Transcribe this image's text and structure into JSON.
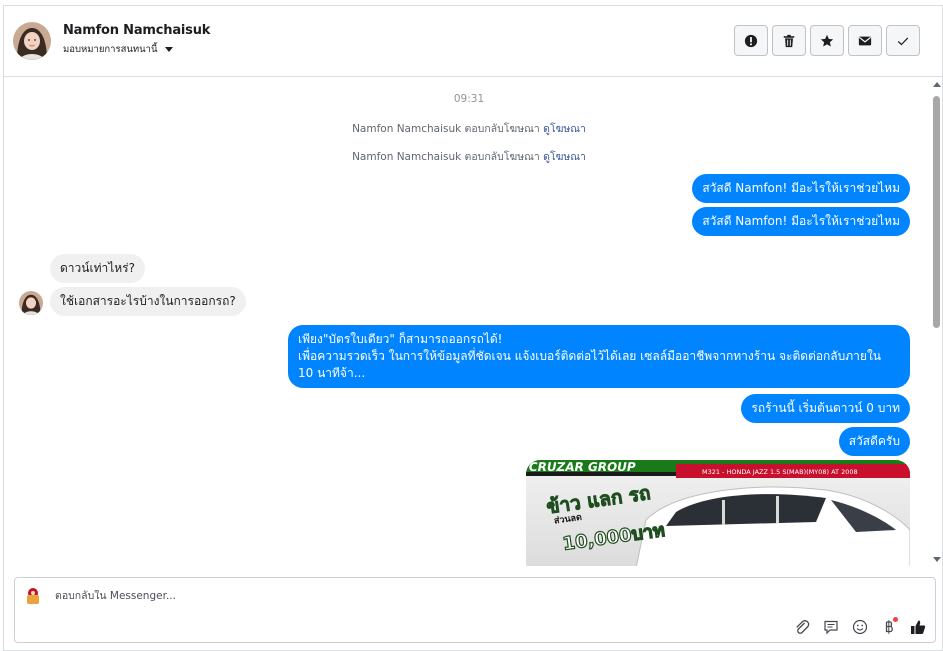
{
  "header": {
    "contact_name": "Namfon Namchaisuk",
    "assign_label": "มอบหมายการสนทนานี้",
    "actions": {
      "spam": "exclamation-icon",
      "delete": "trash-icon",
      "star": "star-icon",
      "unread": "envelope-icon",
      "done": "check-icon"
    }
  },
  "thread": {
    "timestamp": "09:31",
    "notices": [
      {
        "text": "Namfon Namchaisuk ตอบกลับโฆษณา",
        "link": "ดูโฆษณา"
      },
      {
        "text": "Namfon Namchaisuk ตอบกลับโฆษณา",
        "link": "ดูโฆษณา"
      }
    ],
    "messages": [
      {
        "side": "out",
        "text": "สวัสดี Namfon! มีอะไรให้เราช่วยไหม"
      },
      {
        "side": "out",
        "text": "สวัสดี Namfon! มีอะไรให้เราช่วยไหม"
      },
      {
        "side": "in",
        "text": "ดาวน์เท่าไหร่?"
      },
      {
        "side": "in",
        "text": "ใช้เอกสารอะไรบ้างในการออกรถ?"
      },
      {
        "side": "out",
        "line1": "เพียง\"บัตรใบเดียว\" ก็สามารถออกรถได้!",
        "line2": "เพื่อความรวดเร็ว ในการให้ข้อมูลที่ชัดเจน แจ้งเบอร์ติดต่อไว้ได้เลย เซลล์มืออาชีพจากทางร้าน จะติดต่อกลับภายใน 10 นาทีจ้า..."
      },
      {
        "side": "out",
        "text": "รถร้านนี้ เริ่มต้นดาวน์ 0 บาท"
      },
      {
        "side": "out",
        "text": "สวัสดีครับ"
      }
    ],
    "promo_image": {
      "banner_top": "CRUZAR GROUP",
      "model_text": "M321 - HONDA JAZZ 1.5 S(MAB)(MY08) AT 2008",
      "headline": "ข้าว แลก รถ",
      "discount_label": "ส่วนลด",
      "discount_amount": "10,000บาท"
    }
  },
  "composer": {
    "placeholder": "ตอบกลับใน Messenger...",
    "tools": [
      "paperclip-icon",
      "saved-reply-icon",
      "emoji-icon",
      "payment-icon",
      "thumbs-up-icon"
    ]
  },
  "colors": {
    "outgoing_bubble": "#0084ff",
    "incoming_bubble": "#f1f0f0",
    "link": "#385898",
    "notification_dot": "#fa3e3e",
    "promo_red": "#c8102e"
  }
}
